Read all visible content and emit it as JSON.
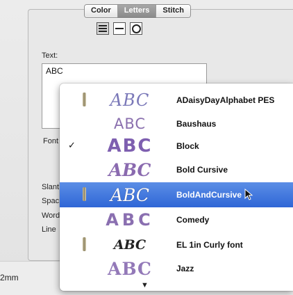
{
  "tabs": [
    {
      "label": "Color",
      "active": false
    },
    {
      "label": "Letters",
      "active": true
    },
    {
      "label": "Stitch",
      "active": false
    }
  ],
  "alignment": {
    "selected": "multiline"
  },
  "form": {
    "text_label": "Text:",
    "text_value": "ABC",
    "font_label": "Font",
    "slant_label": "Slant",
    "spacing_label": "Spac",
    "word_label": "Word",
    "line_label": "Line"
  },
  "font_menu": {
    "items": [
      {
        "label": "ADaisyDayAlphabet PES",
        "preview": "ABC",
        "needle": true,
        "checked": false,
        "highlighted": false
      },
      {
        "label": "Baushaus",
        "preview": "ABC",
        "needle": false,
        "checked": false,
        "highlighted": false
      },
      {
        "label": "Block",
        "preview": "ABC",
        "needle": false,
        "checked": true,
        "highlighted": false
      },
      {
        "label": "Bold Cursive",
        "preview": "ABC",
        "needle": false,
        "checked": false,
        "highlighted": false
      },
      {
        "label": "BoldAndCursive",
        "preview": "ABC",
        "needle": true,
        "checked": false,
        "highlighted": true
      },
      {
        "label": "Comedy",
        "preview": "ABC",
        "needle": false,
        "checked": false,
        "highlighted": false
      },
      {
        "label": "EL 1in Curly font",
        "preview": "ABC",
        "needle": true,
        "checked": false,
        "highlighted": false
      },
      {
        "label": "Jazz",
        "preview": "ABC",
        "needle": false,
        "checked": false,
        "highlighted": false
      }
    ],
    "check_mark": "✓",
    "scroll_down": "▼"
  },
  "bottom": {
    "unit_text": "2mm"
  },
  "colors": {
    "highlight": "#3a6fdc",
    "preview_purple": "#8a6fb0"
  }
}
